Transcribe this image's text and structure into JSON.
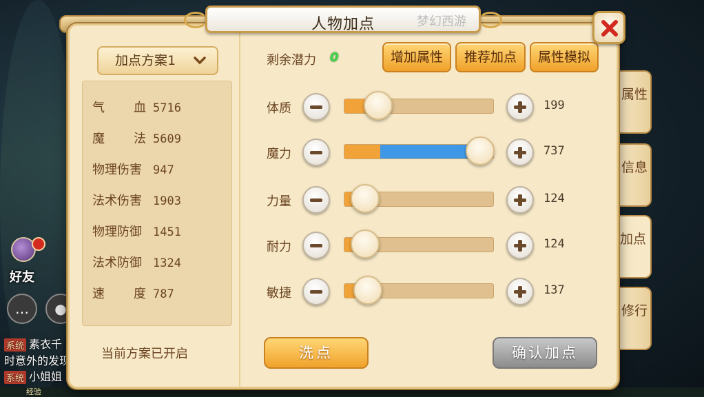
{
  "window": {
    "title": "人物加点",
    "title_calligraphy": "梦幻西游",
    "close_icon": "close-icon",
    "accent_red": "#d32a1f"
  },
  "left_panel": {
    "scheme_selector": "加点方案1",
    "stats": [
      {
        "name": "气血",
        "value": "5716"
      },
      {
        "name": "魔法",
        "value": "5609"
      },
      {
        "name": "物理伤害",
        "value": "947"
      },
      {
        "name": "法术伤害",
        "value": "1903"
      },
      {
        "name": "物理防御",
        "value": "1451"
      },
      {
        "name": "法术防御",
        "value": "1324"
      },
      {
        "name": "速度",
        "value": "787"
      }
    ],
    "status": "当前方案已开启"
  },
  "right_panel": {
    "potential_label": "剩余潜力",
    "potential_value": "0",
    "buttons": {
      "add_attr": "增加属性",
      "recommend": "推荐加点",
      "simulate": "属性模拟"
    },
    "attributes": [
      {
        "name": "体质",
        "value": "199",
        "base_fraction": 0.17,
        "added_fraction": 0.0,
        "knob_fraction": 0.23
      },
      {
        "name": "魔力",
        "value": "737",
        "base_fraction": 0.24,
        "added_fraction": 0.67,
        "knob_fraction": 0.91
      },
      {
        "name": "力量",
        "value": "124",
        "base_fraction": 0.08,
        "added_fraction": 0.0,
        "knob_fraction": 0.14
      },
      {
        "name": "耐力",
        "value": "124",
        "base_fraction": 0.08,
        "added_fraction": 0.0,
        "knob_fraction": 0.14
      },
      {
        "name": "敏捷",
        "value": "137",
        "base_fraction": 0.09,
        "added_fraction": 0.0,
        "knob_fraction": 0.16
      }
    ],
    "reset_label": "洗点",
    "confirm_label": "确认加点"
  },
  "side_tabs": [
    {
      "label": "属性",
      "active": false
    },
    {
      "label": "信息",
      "active": false
    },
    {
      "label": "加点",
      "active": true
    },
    {
      "label": "修行",
      "active": false
    }
  ],
  "overlay": {
    "friend_label": "好友",
    "chat_lines": [
      {
        "tag": "系统",
        "text": "素衣千"
      },
      {
        "tag": "",
        "text": "时意外的发现"
      },
      {
        "tag": "系统",
        "text": "小姐姐"
      }
    ],
    "exp_label": "经验"
  }
}
